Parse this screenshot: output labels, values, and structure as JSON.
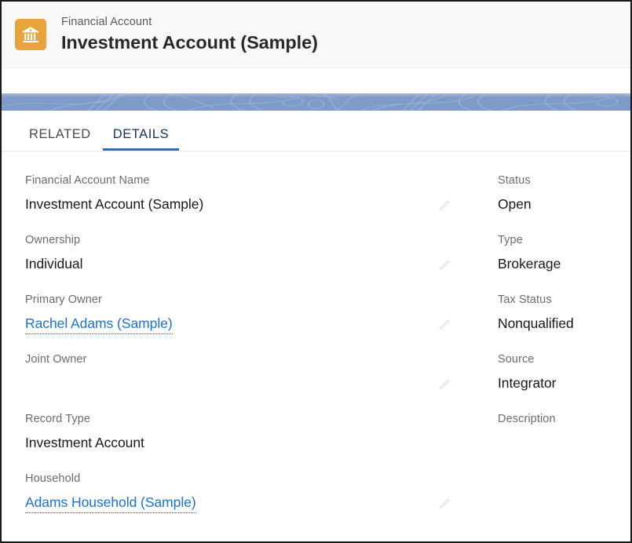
{
  "header": {
    "entity_type": "Financial Account",
    "record_title": "Investment Account (Sample)",
    "icon": "bank-building-icon",
    "icon_bg_color": "#e8a33d"
  },
  "banner": {
    "color": "#7e9bc7",
    "pattern": "abstract-line-art"
  },
  "tabs": [
    {
      "label": "RELATED",
      "active": false
    },
    {
      "label": "DETAILS",
      "active": true
    }
  ],
  "tab_accent_color": "#1b72d0",
  "details": {
    "left_column": [
      {
        "label": "Financial Account Name",
        "value": "Investment Account (Sample)",
        "type": "text",
        "editable": true
      },
      {
        "label": "Ownership",
        "value": "Individual",
        "type": "text",
        "editable": true
      },
      {
        "label": "Primary Owner",
        "value": "Rachel Adams (Sample)",
        "type": "link",
        "editable": true
      },
      {
        "label": "Joint Owner",
        "value": "",
        "type": "text",
        "editable": true
      },
      {
        "label": "Record Type",
        "value": "Investment Account",
        "type": "text",
        "editable": false
      },
      {
        "label": "Household",
        "value": "Adams Household (Sample)",
        "type": "link",
        "editable": true
      }
    ],
    "right_column": [
      {
        "label": "Status",
        "value": "Open",
        "type": "text"
      },
      {
        "label": "Type",
        "value": "Brokerage",
        "type": "text"
      },
      {
        "label": "Tax Status",
        "value": "Nonqualified",
        "type": "text"
      },
      {
        "label": "Source",
        "value": "Integrator",
        "type": "text"
      },
      {
        "label": "Description",
        "value": "",
        "type": "text"
      }
    ]
  },
  "colors": {
    "link": "#1b72d0",
    "label": "#6b6b6b",
    "value": "#181818",
    "header_bg": "#f8f8f7",
    "edit_icon": "#eeeeee"
  }
}
